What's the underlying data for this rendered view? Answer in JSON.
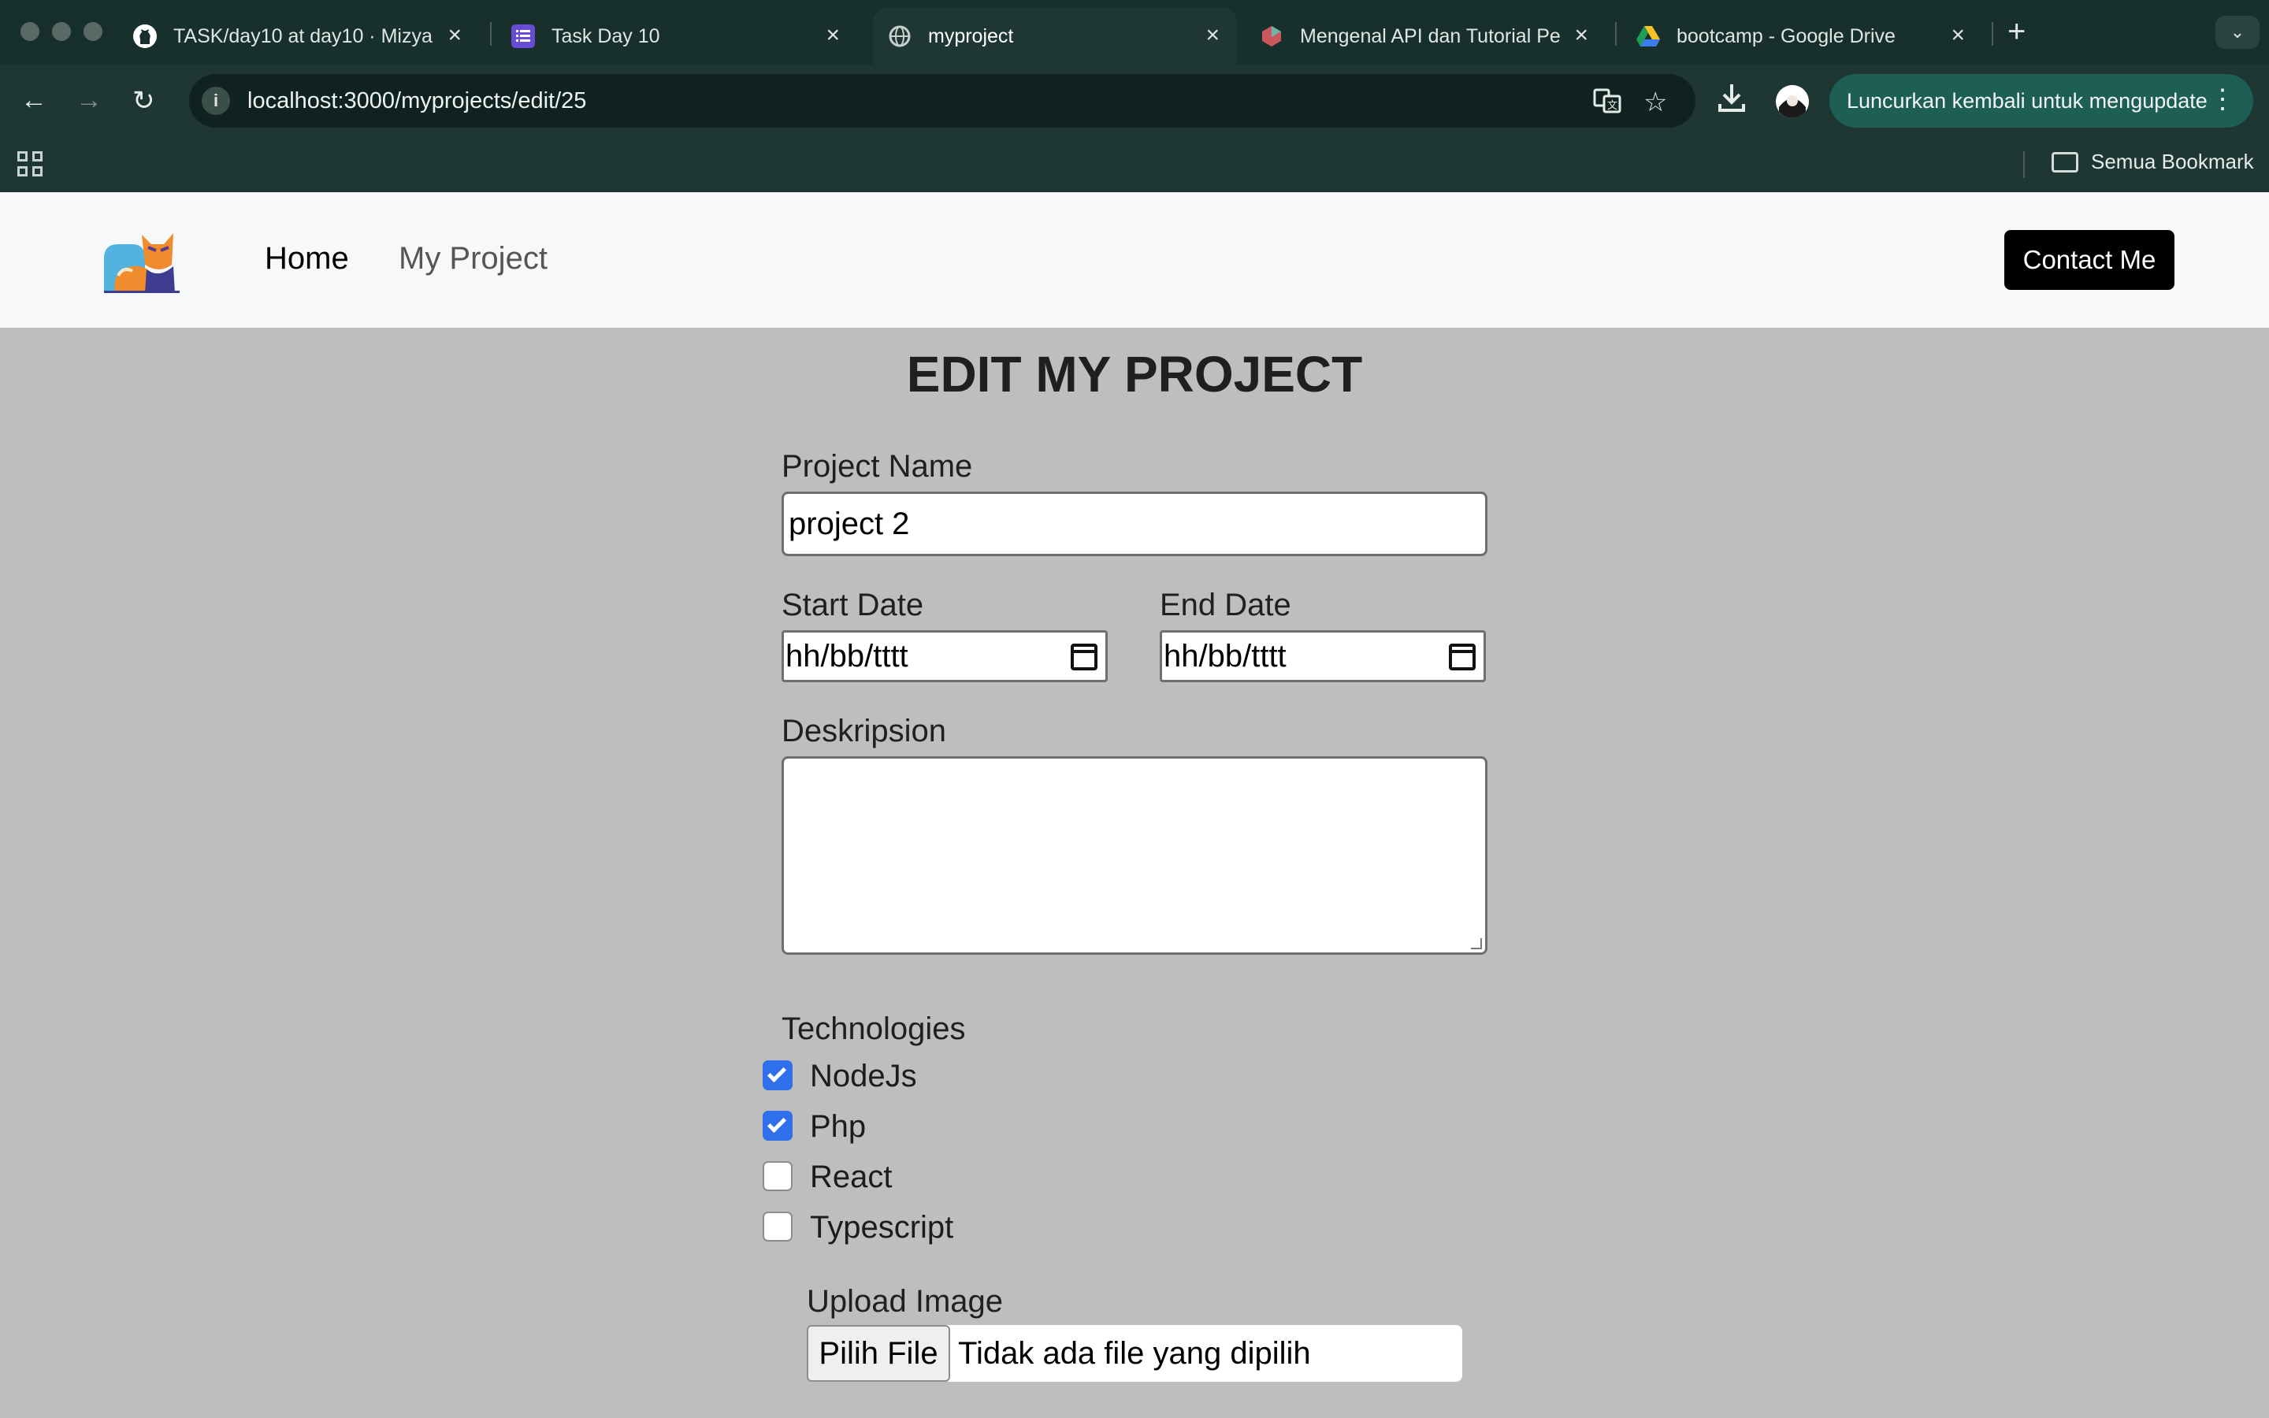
{
  "browser": {
    "tabs": [
      {
        "title": "TASK/day10 at day10 · Mizyal",
        "icon": "github-icon"
      },
      {
        "title": "Task Day 10",
        "icon": "tasks-icon"
      },
      {
        "title": "myproject",
        "icon": "globe-icon"
      },
      {
        "title": "Mengenal API dan Tutorial Pe",
        "icon": "site-icon"
      },
      {
        "title": "bootcamp - Google Drive",
        "icon": "drive-icon"
      }
    ],
    "new_tab": "+",
    "url": "localhost:3000/myprojects/edit/25",
    "update_label": "Luncurkan kembali untuk mengupdate",
    "bookmark_label": "Semua Bookmark"
  },
  "navbar": {
    "home": "Home",
    "my_project": "My Project",
    "contact": "Contact Me"
  },
  "form": {
    "title": "EDIT MY PROJECT",
    "project_name_label": "Project Name",
    "project_name_value": "project 2",
    "start_date_label": "Start Date",
    "start_date_value": "hh/bb/tttt",
    "end_date_label": "End Date",
    "end_date_value": "hh/bb/tttt",
    "description_label": "Deskripsion",
    "technologies_label": "Technologies",
    "technologies": [
      {
        "name": "NodeJs",
        "checked": true
      },
      {
        "name": "Php",
        "checked": true
      },
      {
        "name": "React",
        "checked": false
      },
      {
        "name": "Typescript",
        "checked": false
      }
    ],
    "upload_label": "Upload Image",
    "file_button": "Pilih File",
    "file_status": "Tidak ada file yang dipilih"
  },
  "colors": {
    "page_background": "#bebebe",
    "checkbox_checked": "#2f6fe9",
    "contact_button": "#000000"
  }
}
